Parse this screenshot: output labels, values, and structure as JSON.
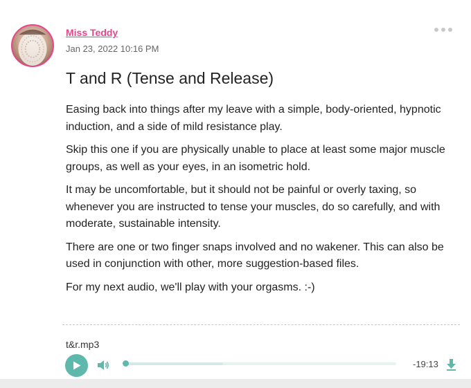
{
  "post": {
    "author": "Miss Teddy",
    "date": "Jan 23, 2022 10:16 PM",
    "title": "T and R (Tense and Release)",
    "paragraphs": [
      "Easing back into things after my leave with a simple, body-oriented, hypnotic induction, and a side of mild resistance play.",
      "Skip this one if you are physically unable to place at least some major muscle groups, as well as your eyes, in an isometric hold.",
      "It may be uncomfortable, but it should not be painful or overly taxing, so whenever you are instructed to tense your muscles, do so carefully, and with moderate, sustainable intensity.",
      "There are one or two finger snaps involved and no wakener. This can also be used in conjunction with other, more suggestion-based files.",
      "For my next audio, we'll play with your orgasms. :-)"
    ]
  },
  "audio": {
    "filename": "t&r.mp3",
    "time_remaining": "-19:13",
    "progress": 0,
    "buffered": 0.36
  },
  "icons": {
    "more": "more-options-icon",
    "play": "play-icon",
    "volume": "volume-icon",
    "download": "download-icon"
  },
  "colors": {
    "accent": "#e8458b",
    "player": "#5fb8ac",
    "background": "#ececec"
  }
}
